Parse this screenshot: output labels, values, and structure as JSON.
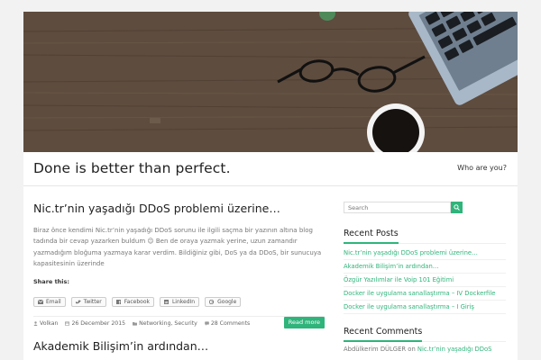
{
  "site": {
    "title": "Done is better than perfect.",
    "menu_item": "Who are you?"
  },
  "posts": [
    {
      "title": "Nic.tr’nin yaşadığı DDoS problemi üzerine…",
      "excerpt": "Biraz önce kendimi Nic.tr’nin yaşadığı DDoS sorunu ile ilgili saçma bir yazının altına blog tadında bir cevap yazarken buldum 😉 Ben de oraya yazmak yerine, uzun zamandır yazmadığım bloğuma yazmaya karar verdim. Bildiğiniz gibi, DoS ya da DDoS, bir sunucuya kapasitesinin üzerinde",
      "share_label": "Share this:",
      "share_buttons": [
        "Email",
        "Twitter",
        "Facebook",
        "LinkedIn",
        "Google"
      ],
      "author": "Volkan",
      "date": "26 December 2015",
      "categories": "Networking, Security",
      "comments": "28 Comments",
      "read_more": "Read more"
    },
    {
      "title": "Akademik Bilişim’in ardından…"
    }
  ],
  "sidebar": {
    "search_placeholder": "Search",
    "recent_posts_title": "Recent Posts",
    "recent_posts": [
      "Nic.tr’nin yaşadığı DDoS problemi üzerine…",
      "Akademik Bilişim’in ardından…",
      "Özgür Yazılımlar ile Voip 101 Eğitimi",
      "Docker ile uygulama sanallaştırma – IV Dockerfile",
      "Docker ile uygulama sanallaştırma – I Giriş"
    ],
    "recent_comments_title": "Recent Comments",
    "recent_comment": {
      "author": "Abdülkerim DÜLGER",
      "on": "on",
      "post": "Nic.tr’nin yaşadığı DDoS"
    }
  },
  "colors": {
    "accent": "#2fb47b",
    "text": "#222222",
    "muted": "#777777"
  },
  "icons": [
    "search-icon",
    "email-icon",
    "twitter-icon",
    "facebook-icon",
    "linkedin-icon",
    "google-icon",
    "user-icon",
    "calendar-icon",
    "folder-icon",
    "comment-icon"
  ]
}
